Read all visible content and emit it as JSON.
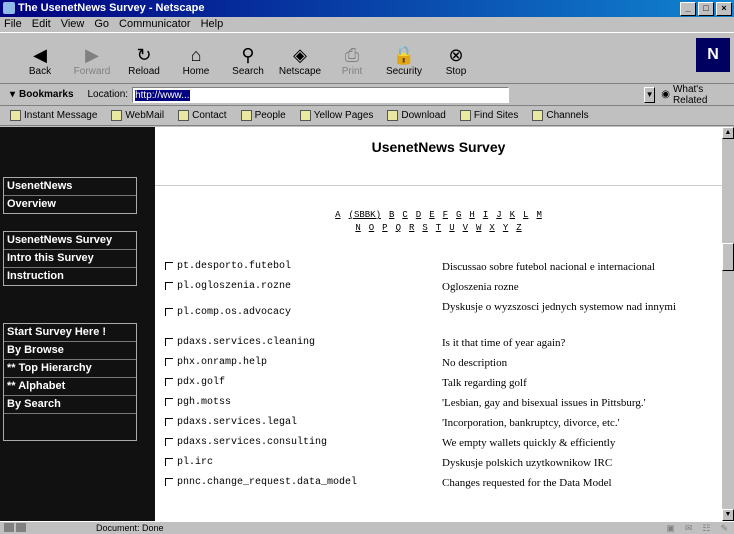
{
  "window": {
    "title": "The UsenetNews Survey - Netscape",
    "btn_min": "_",
    "btn_max": "□",
    "btn_close": "×"
  },
  "menu": [
    "File",
    "Edit",
    "View",
    "Go",
    "Communicator",
    "Help"
  ],
  "toolbar": [
    {
      "label": "Back",
      "icon": "back-arrow-icon",
      "glyph": "◀"
    },
    {
      "label": "Forward",
      "icon": "forward-arrow-icon",
      "glyph": "▶"
    },
    {
      "label": "Reload",
      "icon": "reload-icon",
      "glyph": "↻"
    },
    {
      "label": "Home",
      "icon": "home-icon",
      "glyph": "⌂"
    },
    {
      "label": "Search",
      "icon": "search-icon",
      "glyph": "⚲"
    },
    {
      "label": "Netscape",
      "icon": "netscape-icon",
      "glyph": "◈"
    },
    {
      "label": "Print",
      "icon": "print-icon",
      "glyph": "⎙"
    },
    {
      "label": "Security",
      "icon": "lock-icon",
      "glyph": "🔒"
    },
    {
      "label": "Stop",
      "icon": "stop-icon",
      "glyph": "⊗"
    }
  ],
  "logo": "N",
  "location": {
    "bookmarks_label": "Bookmarks",
    "location_label": "Location:",
    "url": "http://www...",
    "whats_related": "What's Related"
  },
  "personal_toolbar": [
    "Instant Message",
    "WebMail",
    "Contact",
    "People",
    "Yellow Pages",
    "Download",
    "Find Sites",
    "Channels"
  ],
  "sidebar": {
    "group1": [
      "UsenetNews",
      "Overview"
    ],
    "group2": [
      "UsenetNews Survey",
      "Intro this Survey",
      "Instruction"
    ],
    "group3": [
      "Start Survey Here !",
      "By Browse",
      "** Top Hierarchy",
      "** Alphabet",
      "By Search"
    ]
  },
  "page": {
    "title": "UsenetNews Survey",
    "alpha_row1": [
      "A",
      "(SBBK)",
      "B",
      "C",
      "D",
      "E",
      "F",
      "G",
      "H",
      "I",
      "J",
      "K",
      "L",
      "M"
    ],
    "alpha_row2": [
      "N",
      "O",
      "P",
      "Q",
      "R",
      "S",
      "T",
      "U",
      "V",
      "W",
      "X",
      "Y",
      "Z"
    ]
  },
  "groups": [
    {
      "name": "pt.desporto.futebol",
      "desc": "Discussao sobre futebol nacional e internacional"
    },
    {
      "name": "pl.ogloszenia.rozne",
      "desc": "Ogloszenia rozne"
    },
    {
      "name": "pl.comp.os.advocacy",
      "desc": "Dyskusje o wyzszosci jednych systemow nad innymi"
    },
    {
      "name": "pdaxs.services.cleaning",
      "desc": "Is it that time of year again?"
    },
    {
      "name": "phx.onramp.help",
      "desc": "No description"
    },
    {
      "name": "pdx.golf",
      "desc": "Talk regarding golf"
    },
    {
      "name": "pgh.motss",
      "desc": "'Lesbian, gay and bisexual issues in Pittsburg.'"
    },
    {
      "name": "pdaxs.services.legal",
      "desc": "'Incorporation, bankruptcy, divorce, etc.'"
    },
    {
      "name": "pdaxs.services.consulting",
      "desc": "We empty wallets quickly & efficiently"
    },
    {
      "name": "pl.irc",
      "desc": "Dyskusje polskich uzytkownikow IRC"
    },
    {
      "name": "pnnc.change_request.data_model",
      "desc": "Changes requested for the Data Model"
    }
  ],
  "status": {
    "text": "Document: Done"
  }
}
